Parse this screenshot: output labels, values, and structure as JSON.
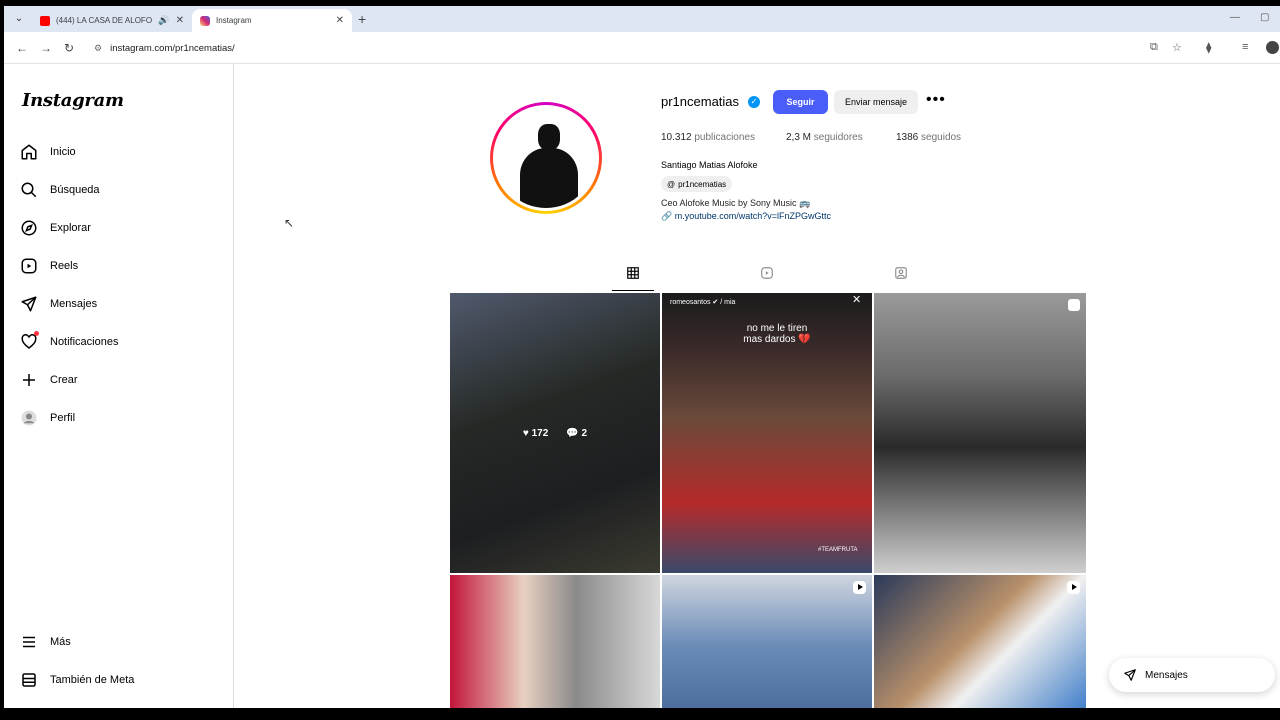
{
  "browser": {
    "tabs": [
      {
        "title": "(444) LA CASA DE ALOFOKE",
        "favicon": "youtube-icon",
        "color": "#ff0000",
        "active": false
      },
      {
        "title": "Instagram",
        "favicon": "instagram-icon",
        "color": "#e1306c",
        "active": true
      }
    ],
    "url": "instagram.com/pr1ncematias/"
  },
  "sidebar": {
    "logo": "Instagram",
    "items": [
      {
        "label": "Inicio",
        "icon": "home-icon"
      },
      {
        "label": "Búsqueda",
        "icon": "search-icon"
      },
      {
        "label": "Explorar",
        "icon": "compass-icon"
      },
      {
        "label": "Reels",
        "icon": "reels-icon"
      },
      {
        "label": "Mensajes",
        "icon": "send-icon"
      },
      {
        "label": "Notificaciones",
        "icon": "heart-icon"
      },
      {
        "label": "Crear",
        "icon": "plus-icon"
      },
      {
        "label": "Perfil",
        "icon": "avatar-icon"
      }
    ],
    "more": "Más",
    "meta": "También de Meta"
  },
  "profile": {
    "username": "pr1ncematias",
    "follow_label": "Seguir",
    "message_label": "Enviar mensaje",
    "stats": {
      "posts_count": "10.312",
      "posts_label": "publicaciones",
      "followers_count": "2,3 M",
      "followers_label": "seguidores",
      "following_count": "1386",
      "following_label": "seguidos"
    },
    "full_name": "Santiago Matias Alofoke",
    "threads_handle": "pr1ncematias",
    "bio": "Ceo Alofoke Music by Sony Music 🚌",
    "link": "m.youtube.com/watch?v=lFnZPGwGttc"
  },
  "grid": {
    "post1": {
      "likes": "172",
      "comments": "2"
    },
    "post2": {
      "header": "romeosantos ✔ / mia",
      "caption": "no me le tiren mas dardos 💔",
      "tag": "#TEAMFRUTA"
    }
  },
  "messages_pill": "Mensajes",
  "colors": {
    "accent": "#4a5df9",
    "verified": "#0095f6",
    "link": "#00376b",
    "notif": "#ff3040"
  }
}
